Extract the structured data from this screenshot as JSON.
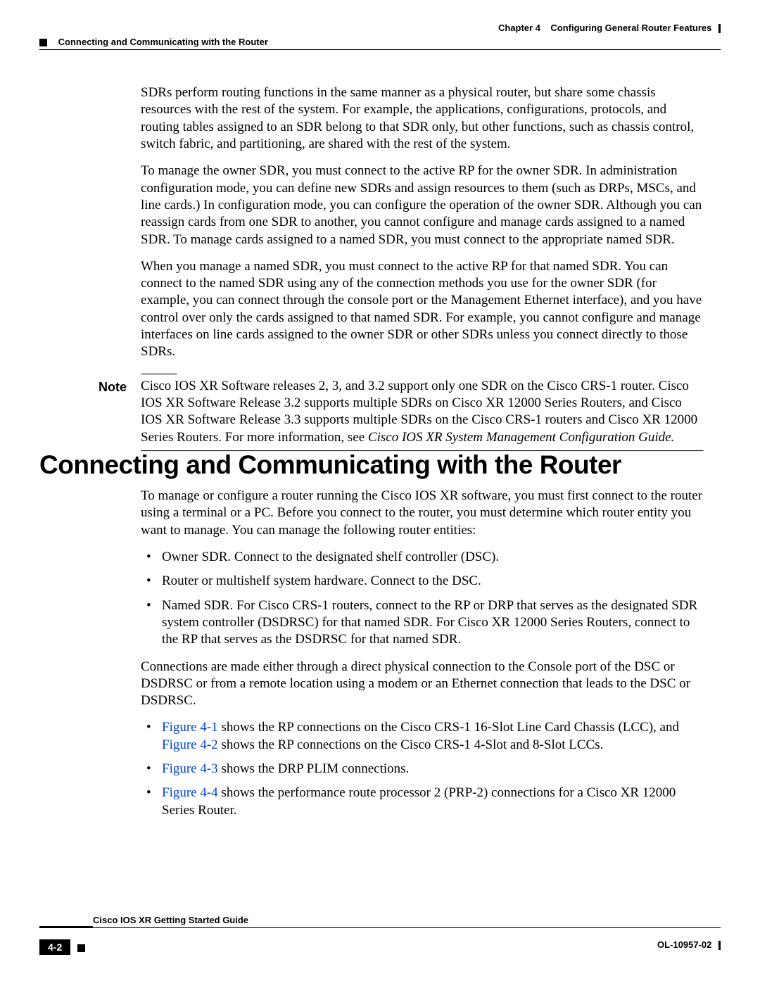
{
  "header": {
    "chapter_label": "Chapter 4",
    "chapter_title": "Configuring General Router Features",
    "section_title": "Connecting and Communicating with the Router"
  },
  "body": {
    "p1": "SDRs perform routing functions in the same manner as a physical router, but share some chassis resources with the rest of the system. For example, the applications, configurations, protocols, and routing tables assigned to an SDR belong to that SDR only, but other functions, such as chassis control, switch fabric, and partitioning, are shared with the rest of the system.",
    "p2": "To manage the owner SDR, you must connect to the active RP for the owner SDR. In administration configuration mode, you can define new SDRs and assign resources to them (such as DRPs, MSCs, and line cards.) In configuration mode, you can configure the operation of the owner SDR. Although you can reassign cards from one SDR to another, you cannot configure and manage cards assigned to a named SDR. To manage cards assigned to a named SDR, you must connect to the appropriate named SDR.",
    "p3": "When you manage a named SDR, you must connect to the active RP for that named SDR. You can connect to the named SDR using any of the connection methods you use for the owner SDR (for example, you can connect through the console port or the Management Ethernet interface), and you have control over only the cards assigned to that named SDR. For example, you cannot configure and manage interfaces on line cards assigned to the owner SDR or other SDRs unless you connect directly to those SDRs."
  },
  "note": {
    "label": "Note",
    "text_a": "Cisco IOS XR Software releases 2, 3, and 3.2 support only one SDR on the Cisco CRS-1 router. Cisco IOS XR Software Release 3.2 supports multiple SDRs on Cisco XR 12000 Series Routers, and Cisco IOS XR Software Release 3.3 supports multiple SDRs on the Cisco CRS-1 routers and Cisco XR 12000 Series Routers. For more information, see ",
    "text_italic": "Cisco IOS XR System Management Configuration Guide.",
    "text_b": ""
  },
  "heading1": "Connecting and Communicating with the Router",
  "section2": {
    "intro": "To manage or configure a router running the Cisco IOS XR software, you must first connect to the router using a terminal or a PC. Before you connect to the router, you must determine which router entity you want to manage. You can manage the following router entities:",
    "bullets1": [
      "Owner SDR. Connect to the designated shelf controller (DSC).",
      "Router or multishelf system hardware. Connect to the DSC.",
      "Named SDR. For Cisco CRS-1 routers, connect to the RP or DRP that serves as the designated SDR system controller (DSDRSC) for that named SDR. For Cisco XR 12000 Series Routers, connect to the RP that serves as the DSDRSC for that named SDR."
    ],
    "para2": "Connections are made either through a direct physical connection to the Console port of the DSC or DSDRSC or from a remote location using a modem or an Ethernet connection that leads to the DSC or DSDRSC.",
    "bullets2": [
      {
        "link1": "Figure 4-1",
        "mid": " shows the RP connections on the Cisco CRS-1 16-Slot Line Card Chassis (LCC), and ",
        "link2": "Figure 4-2",
        "tail": " shows the RP connections on the Cisco CRS-1 4-Slot and 8-Slot LCCs."
      },
      {
        "link1": "Figure 4-3",
        "mid": " shows the DRP PLIM connections.",
        "link2": "",
        "tail": ""
      },
      {
        "link1": "Figure 4-4",
        "mid": " shows the performance route processor 2 (PRP-2) connections for a Cisco XR 12000 Series Router.",
        "link2": "",
        "tail": ""
      }
    ]
  },
  "footer": {
    "guide_title": "Cisco IOS XR Getting Started Guide",
    "page_num": "4-2",
    "doc_num": "OL-10957-02"
  }
}
